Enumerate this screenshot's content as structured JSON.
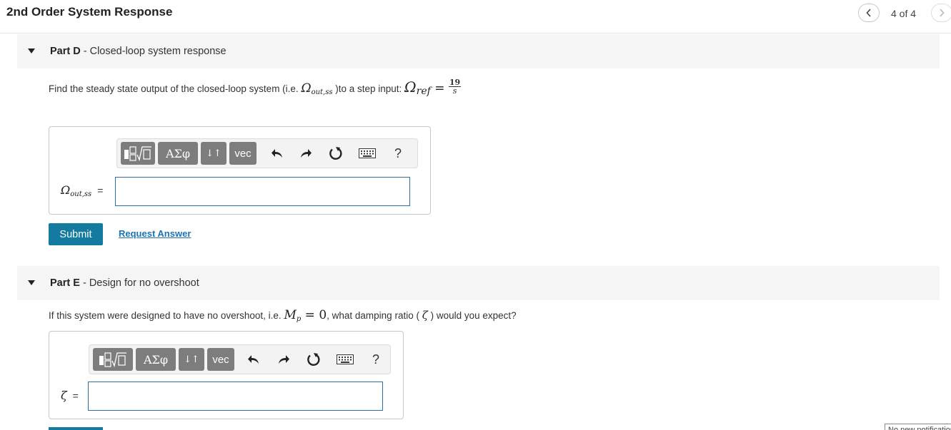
{
  "header": {
    "title": "2nd Order System Response",
    "pager": "4 of 4",
    "prev_icon": "chevron-left-icon",
    "next_icon": "chevron-right-icon"
  },
  "part_d": {
    "label": "Part D",
    "separator": " - ",
    "title": "Closed-loop system response",
    "question_before": "Find the steady state output of the closed-loop system (i.e. ",
    "question_var": "Ω",
    "question_var_sub": "out,ss",
    "question_after": " )to a step input: ",
    "ref_var": "Ω",
    "ref_sub": "ref",
    "ref_eq": " = ",
    "ref_num": "19",
    "ref_den": "s",
    "answer_label": "Ω",
    "answer_label_sub": "out,ss",
    "answer_eq": "=",
    "answer_value": "",
    "submit_label": "Submit",
    "request_label": "Request Answer"
  },
  "part_e": {
    "label": "Part E",
    "separator": " - ",
    "title": "Design for no overshoot",
    "question_before": "If this system were designed to have no overshoot, i.e. ",
    "mp_var": "M",
    "mp_sub": "p",
    "mp_eq": " = 0",
    "question_mid": ", what damping ratio ( ",
    "zeta": "ζ",
    "question_after": " ) would you expect?",
    "answer_label": "ζ",
    "answer_eq": "=",
    "answer_value": ""
  },
  "toolbar": {
    "greek_label": "ΑΣφ",
    "sort_label": "↓↑",
    "vec_label": "vec",
    "help_label": "?",
    "icons": [
      "templates-icon",
      "greek-icon",
      "subscript-icon",
      "vector-icon",
      "undo-icon",
      "redo-icon",
      "reset-icon",
      "keyboard-icon",
      "help-icon"
    ]
  },
  "notification": {
    "text": "No new notifications"
  },
  "colors": {
    "submit_bg": "#147a9f",
    "link": "#1a73b5",
    "input_border": "#2a6fa8",
    "toolbar_btn": "#7d7d7d"
  }
}
